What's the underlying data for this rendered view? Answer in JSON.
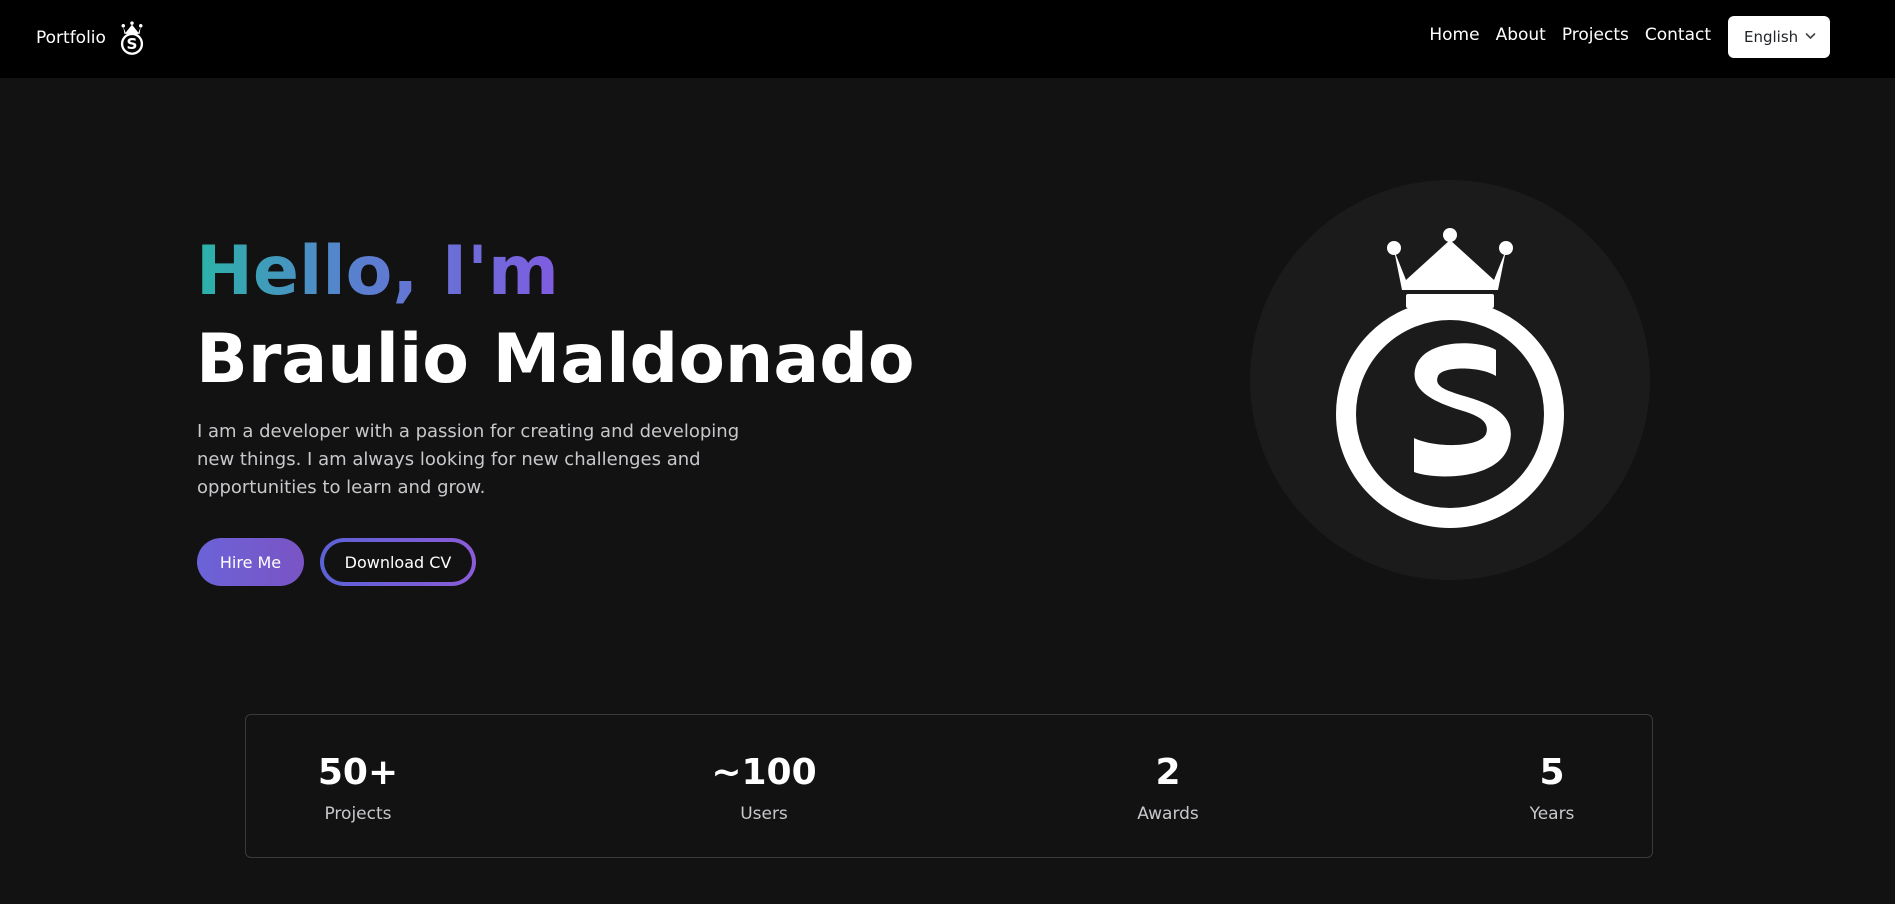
{
  "navbar": {
    "brand": "Portfolio",
    "links": [
      {
        "label": "Home"
      },
      {
        "label": "About"
      },
      {
        "label": "Projects"
      },
      {
        "label": "Contact"
      }
    ],
    "language": {
      "selected": "English"
    }
  },
  "hero": {
    "greeting": "Hello, I'm",
    "name": "Braulio Maldonado",
    "bio": "I am a developer with a passion for creating and developing new things. I am always looking for new challenges and opportunities to learn and grow.",
    "hire_label": "Hire Me",
    "cv_label": "Download CV",
    "logo_icon": "crowned-s-logo-icon"
  },
  "stats": [
    {
      "value": "50+",
      "label": "Projects"
    },
    {
      "value": "~100",
      "label": "Users"
    },
    {
      "value": "2",
      "label": "Awards"
    },
    {
      "value": "5",
      "label": "Years"
    }
  ],
  "colors": {
    "background": "#121212",
    "navbar": "#000000",
    "gradient_start": "#2bb3a8",
    "gradient_mid": "#5a7fd0",
    "gradient_end": "#7f5ce0",
    "button_accent": "#6b63d8"
  }
}
